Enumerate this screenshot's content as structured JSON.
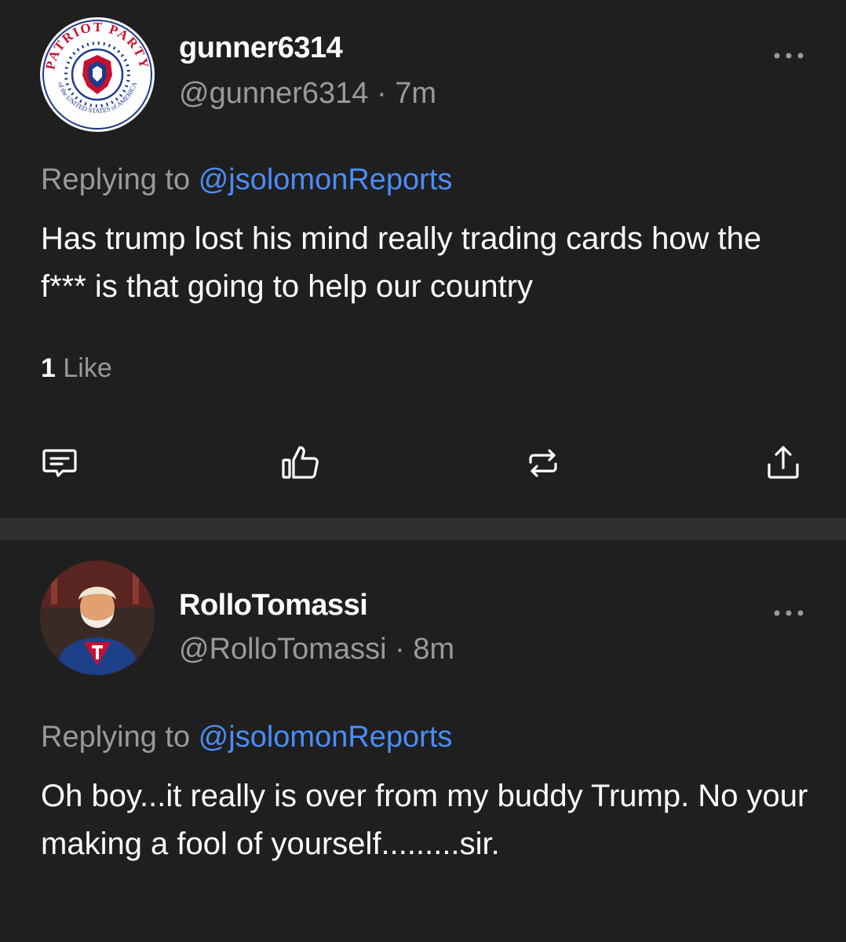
{
  "posts": [
    {
      "display_name": "gunner6314",
      "handle": "@gunner6314",
      "time": "7m",
      "replying_prefix": "Replying to",
      "replying_to": "@jsolomonReports",
      "body": "Has trump lost his mind really trading cards how the f*** is that going to help our country",
      "like_count": "1",
      "like_label": "Like",
      "avatar": {
        "icon": "patriot-party-seal",
        "top_text": "PATRIOT PARTY",
        "bottom_text": "of the UNITED STATES of AMERICA"
      }
    },
    {
      "display_name": "RolloTomassi",
      "handle": "@RolloTomassi",
      "time": "8m",
      "replying_prefix": "Replying to",
      "replying_to": "@jsolomonReports",
      "body": "Oh boy...it really is over from my buddy Trump. No your making a fool of yourself.........sir.",
      "avatar": {
        "icon": "caricature-portrait"
      }
    }
  ],
  "separator_dot": "·",
  "icons": {
    "more": "more-horizontal-icon",
    "comment": "comment-icon",
    "like": "thumbs-up-icon",
    "repost": "repost-icon",
    "share": "share-icon"
  },
  "colors": {
    "background": "#1f1f1f",
    "separator": "#303030",
    "text": "#ffffff",
    "muted": "#9a9a9a",
    "link": "#4b8df8",
    "seal_red": "#c8102e",
    "seal_blue": "#1e3a8a"
  }
}
